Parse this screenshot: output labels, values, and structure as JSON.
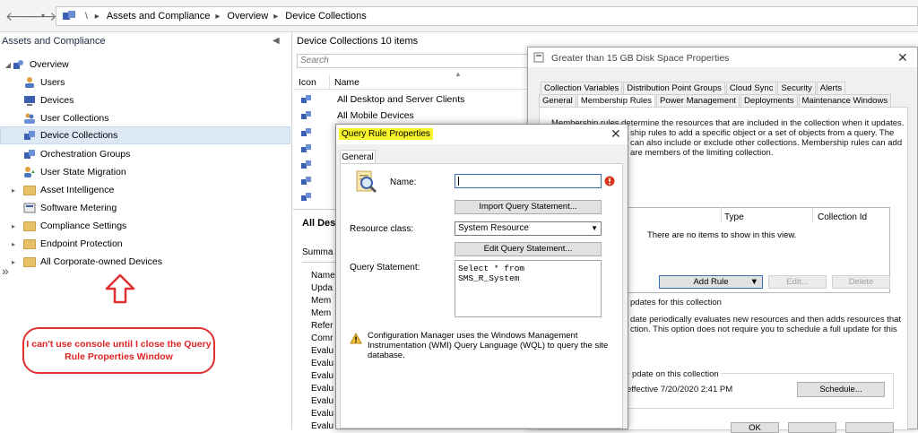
{
  "breadcrumb": {
    "root": "\\",
    "items": [
      "Assets and Compliance",
      "Overview",
      "Device Collections"
    ]
  },
  "left": {
    "title": "Assets and Compliance",
    "items": [
      {
        "label": "Overview",
        "icon": "overview-icon"
      },
      {
        "label": "Users",
        "icon": "user-icon"
      },
      {
        "label": "Devices",
        "icon": "device-icon"
      },
      {
        "label": "User Collections",
        "icon": "user-collection-icon"
      },
      {
        "label": "Device Collections",
        "icon": "device-collection-icon"
      },
      {
        "label": "Orchestration Groups",
        "icon": "orchestration-icon"
      },
      {
        "label": "User State Migration",
        "icon": "migration-icon"
      },
      {
        "label": "Asset Intelligence",
        "icon": "folder-icon"
      },
      {
        "label": "Software Metering",
        "icon": "metering-icon"
      },
      {
        "label": "Compliance Settings",
        "icon": "folder-icon"
      },
      {
        "label": "Endpoint Protection",
        "icon": "folder-icon"
      },
      {
        "label": "All Corporate-owned Devices",
        "icon": "folder-icon"
      }
    ],
    "callout": "I can't use console until I close the Query Rule Properties Window"
  },
  "middle": {
    "title": "Device Collections 10 items",
    "search_placeholder": "Search",
    "columns": [
      "Icon",
      "Name"
    ],
    "rows": [
      "All Desktop and Server Clients",
      "All Mobile Devices"
    ],
    "detail_title": "All Des",
    "summary_label": "Summa",
    "props": [
      "Name",
      "Upda",
      "Mem",
      "Mem",
      "Refer",
      "Comr",
      "Evalu",
      "Evalu",
      "Evalu",
      "Evalu",
      "Evalu",
      "Evalu",
      "Evalu"
    ]
  },
  "properties": {
    "title": "Greater than 15 GB Disk Space Properties",
    "tabs_row1": [
      "Collection Variables",
      "Distribution Point Groups",
      "Cloud Sync",
      "Security",
      "Alerts"
    ],
    "tabs_row2": [
      "General",
      "Membership Rules",
      "Power Management",
      "Deployments",
      "Maintenance Windows"
    ],
    "desc_lines": [
      "Membership rules determine the resources that are included in the collection when it updates.",
      "ship rules to add a specific object or a set of objects from a query. The",
      "can also include or exclude other collections. Membership rules can add",
      "are members of the limiting collection."
    ],
    "table_headers": [
      "Type",
      "Collection Id"
    ],
    "empty_text": "There are no items to show in this view.",
    "add_rule": "Add Rule",
    "edit": "Edit...",
    "delete": "Delete",
    "updates_text": "pdates for this collection",
    "incr_lines": [
      "date periodically evaluates new resources and then adds resources that",
      "ction. This option does not require you to schedule a full update for this"
    ],
    "full_update": "pdate on this collection",
    "effective": "effective 7/20/2020 2:41 PM",
    "schedule": "Schedule...",
    "ok": "OK"
  },
  "query": {
    "title": "Query Rule Properties",
    "tab": "General",
    "name_label": "Name:",
    "import": "Import Query Statement...",
    "resource_label": "Resource class:",
    "resource_value": "System Resource",
    "edit_query": "Edit Query Statement...",
    "statement_label": "Query Statement:",
    "statement": "Select * from\nSMS_R_System",
    "warning": "Configuration Manager uses the Windows Management Instrumentation (WMI) Query Language (WQL) to query the site database."
  },
  "colors": {
    "callout": "#e02424",
    "highlight": "#f7f32a",
    "accent": "#3b5fae"
  }
}
